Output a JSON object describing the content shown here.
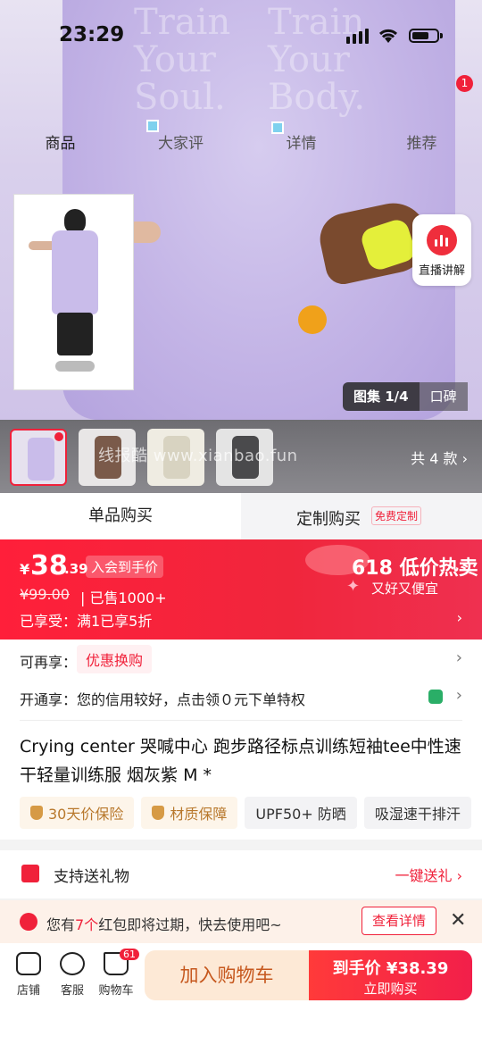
{
  "status_bar": {
    "time": "23:29"
  },
  "notification_count": "1",
  "nav_tabs": [
    "商品",
    "大家评",
    "详情",
    "推荐"
  ],
  "hero": {
    "print_text_left": "Train\nYour\nSoul.",
    "print_text_right": "Train\nYour\nBody.",
    "live_label": "直播讲解",
    "gallery_label": "图集 1/4",
    "reputation_label": "口碑"
  },
  "variants": {
    "count_label": "共 4 款",
    "watermark": "线报酷 www.xianbao.fun",
    "colors": [
      "#c9bcea",
      "#7a5a4a",
      "#d8d3c1",
      "#4a4a4c"
    ]
  },
  "purchase_modes": {
    "single": "单品购买",
    "custom": "定制购买",
    "custom_tag": "免费定制"
  },
  "price": {
    "currency": "¥",
    "integer": "38",
    "decimal": ".39",
    "member_tag": "入会到手价",
    "original": "¥99.00",
    "sold": "已售1000+",
    "enjoyed": "已享受：满1已享5折",
    "promo_title": "618 低价热卖",
    "promo_sub": "又好又便宜"
  },
  "offers": {
    "more_label": "可再享：",
    "coupon_tag": "优惠换购",
    "credit_text": "开通享：您的信用较好，点击领０元下单特权"
  },
  "product": {
    "title": "Crying center 哭喊中心 跑步路径标点训练短袖tee中性速干轻量训练服 烟灰紫 M *"
  },
  "chips": [
    "30天价保险",
    "材质保障",
    "UPF50+ 防晒",
    "吸湿速干排汗"
  ],
  "gift": {
    "label": "支持送礼物",
    "action": "一键送礼"
  },
  "expiring": {
    "prefix": "您有",
    "count": "7个",
    "suffix": "红包即将过期，快去使用吧~",
    "button": "查看详情"
  },
  "bottom_bar": {
    "store": "店铺",
    "service": "客服",
    "cart": "购物车",
    "cart_count": "61",
    "add_to_cart": "加入购物车",
    "buy_line1": "到手价 ¥38.39",
    "buy_line2": "立即购买"
  },
  "colors": {
    "accent": "#f0213a",
    "cart_bg": "#fde9d6",
    "cart_text": "#c6581e"
  }
}
